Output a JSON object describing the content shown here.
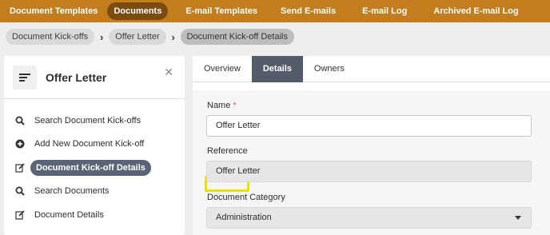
{
  "topnav": {
    "items": [
      {
        "label": "Document Templates"
      },
      {
        "label": "Documents",
        "active": true
      },
      {
        "label": "E-mail Templates"
      },
      {
        "label": "Send E-mails"
      },
      {
        "label": "E-mail Log"
      },
      {
        "label": "Archived E-mail Log"
      }
    ],
    "background": "#c37d1c"
  },
  "breadcrumb": {
    "items": [
      {
        "label": "Document Kick-offs"
      },
      {
        "label": "Offer Letter"
      },
      {
        "label": "Document Kick-off Details",
        "current": true
      }
    ]
  },
  "sidebar": {
    "title": "Offer Letter",
    "items": [
      {
        "label": "Search Document Kick-offs",
        "icon": "search-icon"
      },
      {
        "label": "Add New Document Kick-off",
        "icon": "plus-circle-icon"
      },
      {
        "label": "Document Kick-off Details",
        "icon": "edit-icon",
        "active": true
      },
      {
        "label": "Search Documents",
        "icon": "search-icon"
      },
      {
        "label": "Document Details",
        "icon": "edit-icon"
      }
    ]
  },
  "tabs": [
    {
      "label": "Overview"
    },
    {
      "label": "Details",
      "active": true
    },
    {
      "label": "Owners"
    }
  ],
  "form": {
    "name_label": "Name",
    "required_mark": "*",
    "name_value": "Offer Letter",
    "reference_label": "Reference",
    "reference_value": "Offer Letter",
    "category_label": "Document Category",
    "category_value": "Administration"
  },
  "colors": {
    "accent_pill": "#5b6377",
    "highlight_box": "#f0e000"
  }
}
